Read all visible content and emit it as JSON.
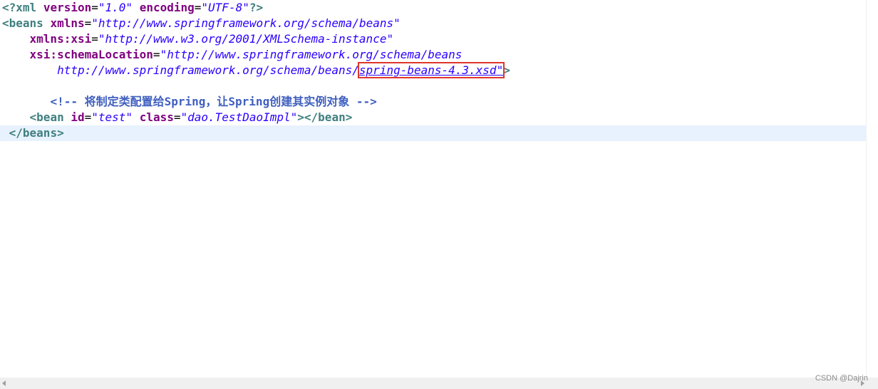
{
  "lines": {
    "l1": {
      "open": "<?",
      "tag": "xml",
      "a1": "version",
      "v1": "\"1.0\"",
      "a2": "encoding",
      "v2": "\"UTF-8\"",
      "close": "?>"
    },
    "l2": {
      "open": "<",
      "tag": "beans",
      "attr": "xmlns",
      "val": "\"http://www.springframework.org/schema/beans\""
    },
    "l3": {
      "indent": "    ",
      "attr": "xmlns:xsi",
      "val": "\"http://www.w3.org/2001/XMLSchema-instance\""
    },
    "l4": {
      "indent": "    ",
      "attr": "xsi:schemaLocation",
      "val": "\"http://www.springframework.org/schema/beans"
    },
    "l5": {
      "indent": "        ",
      "val_plain": "http://www.springframework.org/schema/beans/",
      "val_highlight": "spring-beans-4.3.xsd\"",
      "close": ">"
    },
    "l7": {
      "indent": "       ",
      "comment": "<!-- 将制定类配置给Spring，让Spring创建其实例对象 -->"
    },
    "l8": {
      "indent": "    ",
      "open": "<",
      "tag": "bean",
      "a1": "id",
      "v1": "\"test\"",
      "a2": "class",
      "v2": "\"dao.TestDaoImpl\"",
      "close": "></",
      "tag2": "bean",
      "close2": ">"
    },
    "l9": {
      "indent": " ",
      "text": "</beans>"
    }
  },
  "symbols": {
    "eq": "=",
    "space": " "
  },
  "watermark": "CSDN @Dajrin",
  "colors": {
    "tag": "#3f7f7f",
    "attribute": "#7f007f",
    "value": "#2a00ff",
    "comment": "#3f5fbf",
    "highlight_box": "#e0352b",
    "current_line": "#e8f2fe"
  }
}
